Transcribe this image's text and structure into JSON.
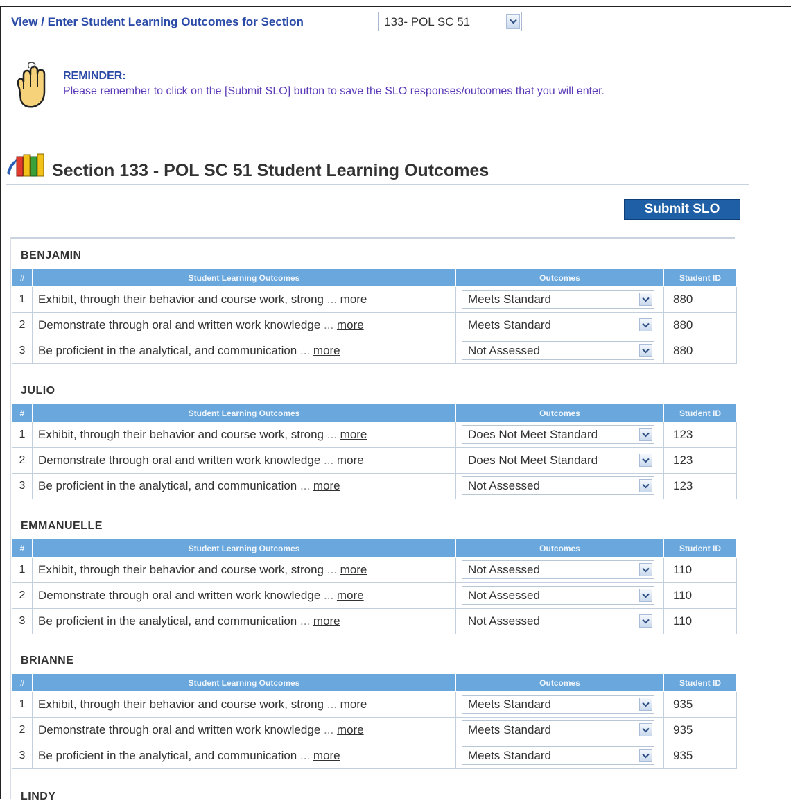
{
  "header": {
    "view_label": "View / Enter Student Learning Outcomes for Section",
    "section_select_value": "133- POL SC 51"
  },
  "reminder": {
    "title": "REMINDER:",
    "text": "Please remember to click on the [Submit SLO] button to save the SLO responses/outcomes that you will enter."
  },
  "section_title": "Section 133 - POL SC 51 Student Learning Outcomes",
  "submit_label": "Submit SLO",
  "table_headers": {
    "num": "#",
    "slo": "Student Learning Outcomes",
    "outcomes": "Outcomes",
    "student_id": "Student ID"
  },
  "more_label": "more",
  "ellipsis": "...",
  "icons": {
    "reminder": "finger-string-icon",
    "section": "books-icon",
    "dropdown": "chevron-down-icon"
  },
  "colors": {
    "header_bg": "#6aa7dc",
    "submit_bg": "#1e5fa6",
    "link_blue": "#2a4aa8",
    "reminder_purple": "#5b3ab8"
  },
  "students": [
    {
      "name": "BENJAMIN",
      "rows": [
        {
          "num": "1",
          "text": "Exhibit, through their behavior and course work, strong",
          "outcome": "Meets Standard",
          "id": "880"
        },
        {
          "num": "2",
          "text": "Demonstrate through oral and written work knowledge",
          "outcome": "Meets Standard",
          "id": "880"
        },
        {
          "num": "3",
          "text": "Be proficient in the analytical, and communication",
          "outcome": "Not Assessed",
          "id": "880"
        }
      ]
    },
    {
      "name": "JULIO",
      "rows": [
        {
          "num": "1",
          "text": "Exhibit, through their behavior and course work, strong",
          "outcome": "Does Not Meet Standard",
          "id": "123"
        },
        {
          "num": "2",
          "text": "Demonstrate through oral and written work knowledge",
          "outcome": "Does Not Meet Standard",
          "id": "123"
        },
        {
          "num": "3",
          "text": "Be proficient in the analytical, and communication",
          "outcome": "Not Assessed",
          "id": "123"
        }
      ]
    },
    {
      "name": "EMMANUELLE",
      "rows": [
        {
          "num": "1",
          "text": "Exhibit, through their behavior and course work, strong",
          "outcome": "Not Assessed",
          "id": "110"
        },
        {
          "num": "2",
          "text": "Demonstrate through oral and written work knowledge",
          "outcome": "Not Assessed",
          "id": "110"
        },
        {
          "num": "3",
          "text": "Be proficient in the analytical, and communication",
          "outcome": "Not Assessed",
          "id": "110"
        }
      ]
    },
    {
      "name": "BRIANNE",
      "rows": [
        {
          "num": "1",
          "text": "Exhibit, through their behavior and course work, strong",
          "outcome": "Meets Standard",
          "id": "935"
        },
        {
          "num": "2",
          "text": "Demonstrate through oral and written work knowledge",
          "outcome": "Meets Standard",
          "id": "935"
        },
        {
          "num": "3",
          "text": "Be proficient in the analytical, and communication",
          "outcome": "Meets Standard",
          "id": "935"
        }
      ]
    },
    {
      "name": "LINDY",
      "rows": []
    }
  ]
}
